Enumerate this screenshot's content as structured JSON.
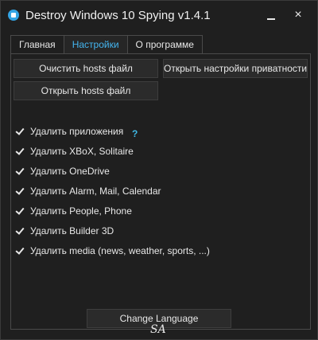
{
  "window": {
    "title": "Destroy Windows 10 Spying v1.4.1",
    "minimize_label": "",
    "close_label": "×"
  },
  "tabs": [
    {
      "label": "Главная",
      "active": false
    },
    {
      "label": "Настройки",
      "active": true
    },
    {
      "label": "О программе",
      "active": false
    }
  ],
  "buttons": {
    "clear_hosts": "Очистить hosts файл",
    "open_privacy": "Открыть настройки приватности",
    "open_hosts": "Открыть hosts файл",
    "change_language": "Change Language"
  },
  "options": [
    {
      "label": "Удалить приложения",
      "checked": true
    },
    {
      "label": "Удалить XBoX, Solitaire",
      "checked": true
    },
    {
      "label": "Удалить OneDrive",
      "checked": true
    },
    {
      "label": "Удалить Alarm, Mail, Calendar",
      "checked": true
    },
    {
      "label": "Удалить People, Phone",
      "checked": true
    },
    {
      "label": "Удалить Builder 3D",
      "checked": true
    },
    {
      "label": "Удалить media (news, weather, sports, ...)",
      "checked": true
    }
  ],
  "help_mark": "?",
  "signature": "SA",
  "colors": {
    "background": "#1f1f1f",
    "accent": "#44b5f0",
    "help": "#3fb9e6"
  }
}
